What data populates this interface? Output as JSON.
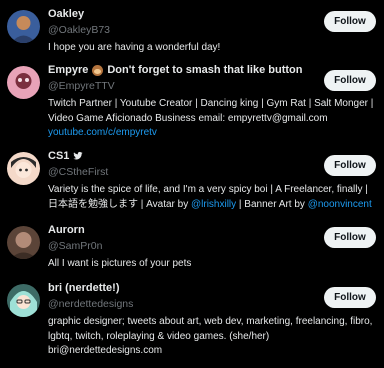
{
  "users": [
    {
      "name": "Oakley",
      "handle": "@OakleyB73",
      "bio": "I hope you are having a wonderful day!",
      "follow_label": "Follow",
      "avatar_colors": [
        "#c68a5a",
        "#3a5e9c"
      ]
    },
    {
      "name": "Empyre",
      "name_suffix": "Don't forget to smash that like button",
      "handle": "@EmpyreTTV",
      "bio": "Twitch Partner | Youtube Creator | Dancing king | Gym Rat | Salt Monger | Video Game Aficionado Business email: empyrettv@gmail.com",
      "link": "youtube.com/c/empyretv",
      "follow_label": "Follow",
      "avatar_colors": [
        "#e8a3b8",
        "#7a2f3e"
      ]
    },
    {
      "name": "CS1",
      "handle": "@CStheFirst",
      "bio_parts": [
        "Variety is the spice of life, and I'm a very spicy boi | A Freelancer, finally | 日本語を勉強します | Avatar by ",
        "@lrishxilly",
        " | Banner Art by ",
        "@noonvincent"
      ],
      "follow_label": "Follow",
      "avatar_colors": [
        "#f4d9c9",
        "#2b2b2b"
      ]
    },
    {
      "name": "Aurorn",
      "handle": "@SamPr0n",
      "bio": "All I want is pictures of your pets",
      "follow_label": "Follow",
      "avatar_colors": [
        "#b28b78",
        "#5b4438"
      ]
    },
    {
      "name": "bri (nerdette!)",
      "handle": "@nerdettedesigns",
      "bio": "graphic designer; tweets about art, web dev, marketing, freelancing, fibro, lgbtq, twitch, roleplaying & video games. (she/her) bri@nerdettedesigns.com",
      "follow_label": "Follow",
      "avatar_colors": [
        "#9ee0d6",
        "#3d6b66"
      ]
    }
  ],
  "colors": {
    "background": "#000000",
    "text": "#e7e9ea",
    "muted": "#71767b",
    "link": "#1d9bf0",
    "button_bg": "#eff3f4"
  }
}
